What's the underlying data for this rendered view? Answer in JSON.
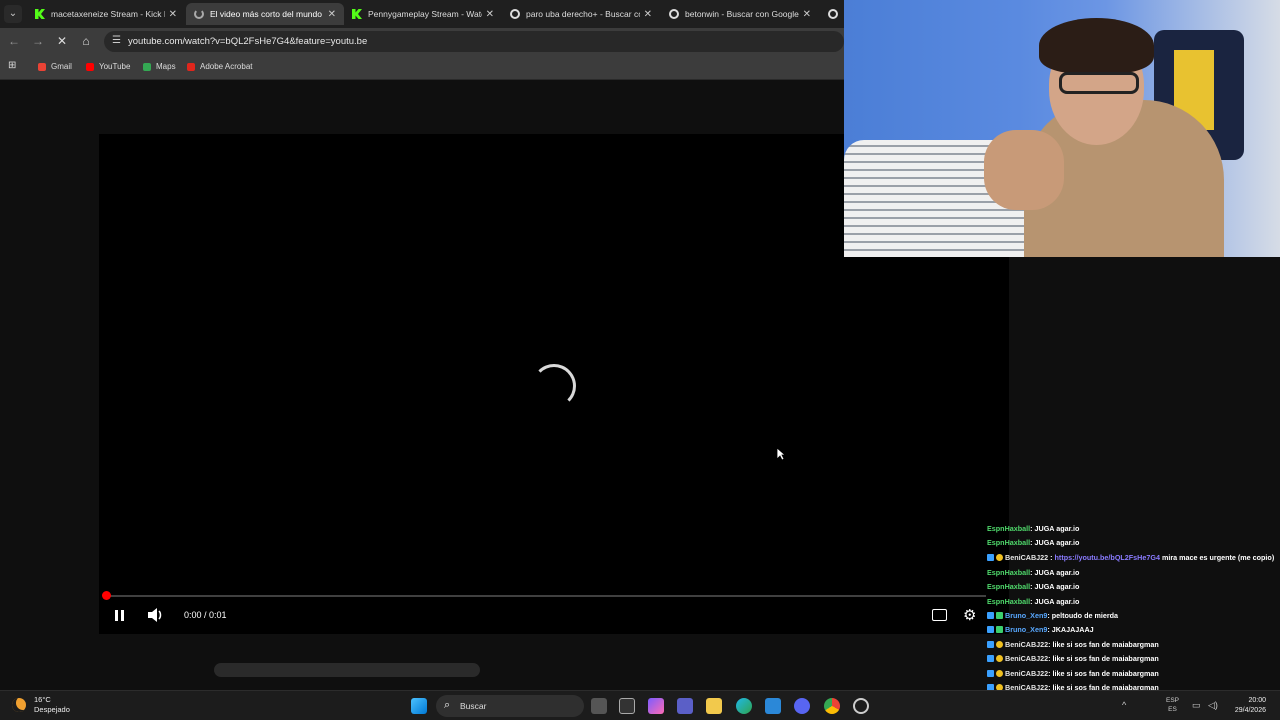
{
  "browser": {
    "tabs": [
      {
        "title": "macetaxeneize Stream - Kick D",
        "favicon": "kick-icon",
        "active": false
      },
      {
        "title": "El video más corto del mundo",
        "favicon": "loading-icon",
        "active": true
      },
      {
        "title": "Pennygameplay Stream - Watc",
        "favicon": "kick-icon",
        "active": false
      },
      {
        "title": "paro uba derecho+ - Buscar co",
        "favicon": "google-icon",
        "active": false
      },
      {
        "title": "betonwin - Buscar con Google",
        "favicon": "google-icon",
        "active": false
      },
      {
        "title": "r",
        "favicon": "google-icon",
        "active": false
      }
    ],
    "url": "youtube.com/watch?v=bQL2FsHe7G4&feature=youtu.be",
    "bookmarks": [
      {
        "label": "Gmail",
        "color": "#ea4335"
      },
      {
        "label": "YouTube",
        "color": "#ff0000"
      },
      {
        "label": "Maps",
        "color": "#34a853"
      },
      {
        "label": "Adobe Acrobat",
        "color": "#e0261c"
      }
    ]
  },
  "player": {
    "time": "0:00 / 0:01",
    "progress": 0,
    "state": "loading"
  },
  "chat": [
    {
      "user": "EspnHaxball",
      "color": "green",
      "badges": [],
      "text": ": JUGA agar.io"
    },
    {
      "user": "EspnHaxball",
      "color": "green",
      "badges": [],
      "text": ": JUGA agar.io"
    },
    {
      "user": "BeniCABJ22",
      "color": "white",
      "badges": [
        "blue",
        "gold"
      ],
      "link": "https://youtu.be/bQL2FsHe7G4",
      "text": " mira mace es urgente (me copio)"
    },
    {
      "user": "EspnHaxball",
      "color": "green",
      "badges": [],
      "text": ": JUGA agar.io"
    },
    {
      "user": "EspnHaxball",
      "color": "green",
      "badges": [],
      "text": ": JUGA agar.io"
    },
    {
      "user": "EspnHaxball",
      "color": "green",
      "badges": [],
      "text": ": JUGA agar.io"
    },
    {
      "user": "Bruno_Xen9",
      "color": "blue",
      "badges": [
        "blue",
        "green"
      ],
      "text": ": peltoudo de mierda"
    },
    {
      "user": "Bruno_Xen9",
      "color": "blue",
      "badges": [
        "blue",
        "green"
      ],
      "text": ": JKAJAJAAJ"
    },
    {
      "user": "BeniCABJ22",
      "color": "white",
      "badges": [
        "blue",
        "gold"
      ],
      "text": ": like si sos fan de maiabargman"
    },
    {
      "user": "BeniCABJ22",
      "color": "white",
      "badges": [
        "blue",
        "gold"
      ],
      "text": ": like si sos fan de maiabargman"
    },
    {
      "user": "BeniCABJ22",
      "color": "white",
      "badges": [
        "blue",
        "gold"
      ],
      "text": ": like si sos fan de maiabargman"
    },
    {
      "user": "BeniCABJ22",
      "color": "white",
      "badges": [
        "blue",
        "gold"
      ],
      "text": ": like si sos fan de maiabargman"
    },
    {
      "user": "BeniCABJ22",
      "color": "white",
      "badges": [
        "blue",
        "gold"
      ],
      "text": ": like si sos fan de maiabargman"
    }
  ],
  "taskbar": {
    "weather_temp": "16°C",
    "weather_desc": "Despejado",
    "search_label": "Buscar",
    "lang": "ESP",
    "lang_sub": "ES",
    "time": "20:00",
    "date": "29/4/2026"
  }
}
